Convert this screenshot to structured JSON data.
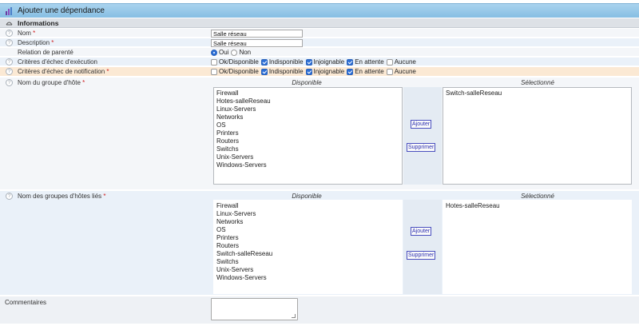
{
  "page": {
    "title": "Ajouter une dépendance",
    "section": "Informations"
  },
  "fields": {
    "name": {
      "label": "Nom",
      "required_mark": "*",
      "value": "Salle réseau"
    },
    "description": {
      "label": "Description",
      "required_mark": "*",
      "value": "Salle réseau"
    },
    "relation": {
      "label": "Relation de parenté",
      "options": [
        "Oui",
        "Non"
      ],
      "selected": "Oui"
    },
    "exec_criteria": {
      "label": "Critères d'échec d'exécution",
      "options": [
        {
          "label": "Ok/Disponible",
          "checked": false
        },
        {
          "label": "Indisponible",
          "checked": true
        },
        {
          "label": "Injoignable",
          "checked": true
        },
        {
          "label": "En attente",
          "checked": true
        },
        {
          "label": "Aucune",
          "checked": false
        }
      ]
    },
    "notif_criteria": {
      "label": "Critères d'échec de notification",
      "required_mark": "*",
      "options": [
        {
          "label": "Ok/Disponible",
          "checked": false
        },
        {
          "label": "Indisponible",
          "checked": true
        },
        {
          "label": "Injoignable",
          "checked": true
        },
        {
          "label": "En attente",
          "checked": true
        },
        {
          "label": "Aucune",
          "checked": false
        }
      ]
    },
    "hostgroup": {
      "label": "Nom du groupe d'hôte",
      "required_mark": "*",
      "available_header": "Disponible",
      "selected_header": "Sélectionné",
      "available": [
        "Firewall",
        "Hotes-salleReseau",
        "Linux-Servers",
        "Networks",
        "OS",
        "Printers",
        "Routers",
        "Switchs",
        "Unix-Servers",
        "Windows-Servers"
      ],
      "selected": [
        "Switch-salleReseau"
      ],
      "add_label": "Ajouter",
      "remove_label": "Supprimer"
    },
    "linked_hostgroups": {
      "label": "Nom des groupes d'hôtes liés",
      "required_mark": "*",
      "available_header": "Disponible",
      "selected_header": "Sélectionné",
      "available": [
        "Firewall",
        "Linux-Servers",
        "Networks",
        "OS",
        "Printers",
        "Routers",
        "Switch-salleReseau",
        "Switchs",
        "Unix-Servers",
        "Windows-Servers"
      ],
      "selected": [
        "Hotes-salleReseau"
      ],
      "add_label": "Ajouter",
      "remove_label": "Supprimer"
    },
    "comments": {
      "label": "Commentaires",
      "value": ""
    }
  },
  "icons": {
    "title": "dependency-icon",
    "section": "collapse-arrow-icon",
    "help": "help-icon"
  }
}
